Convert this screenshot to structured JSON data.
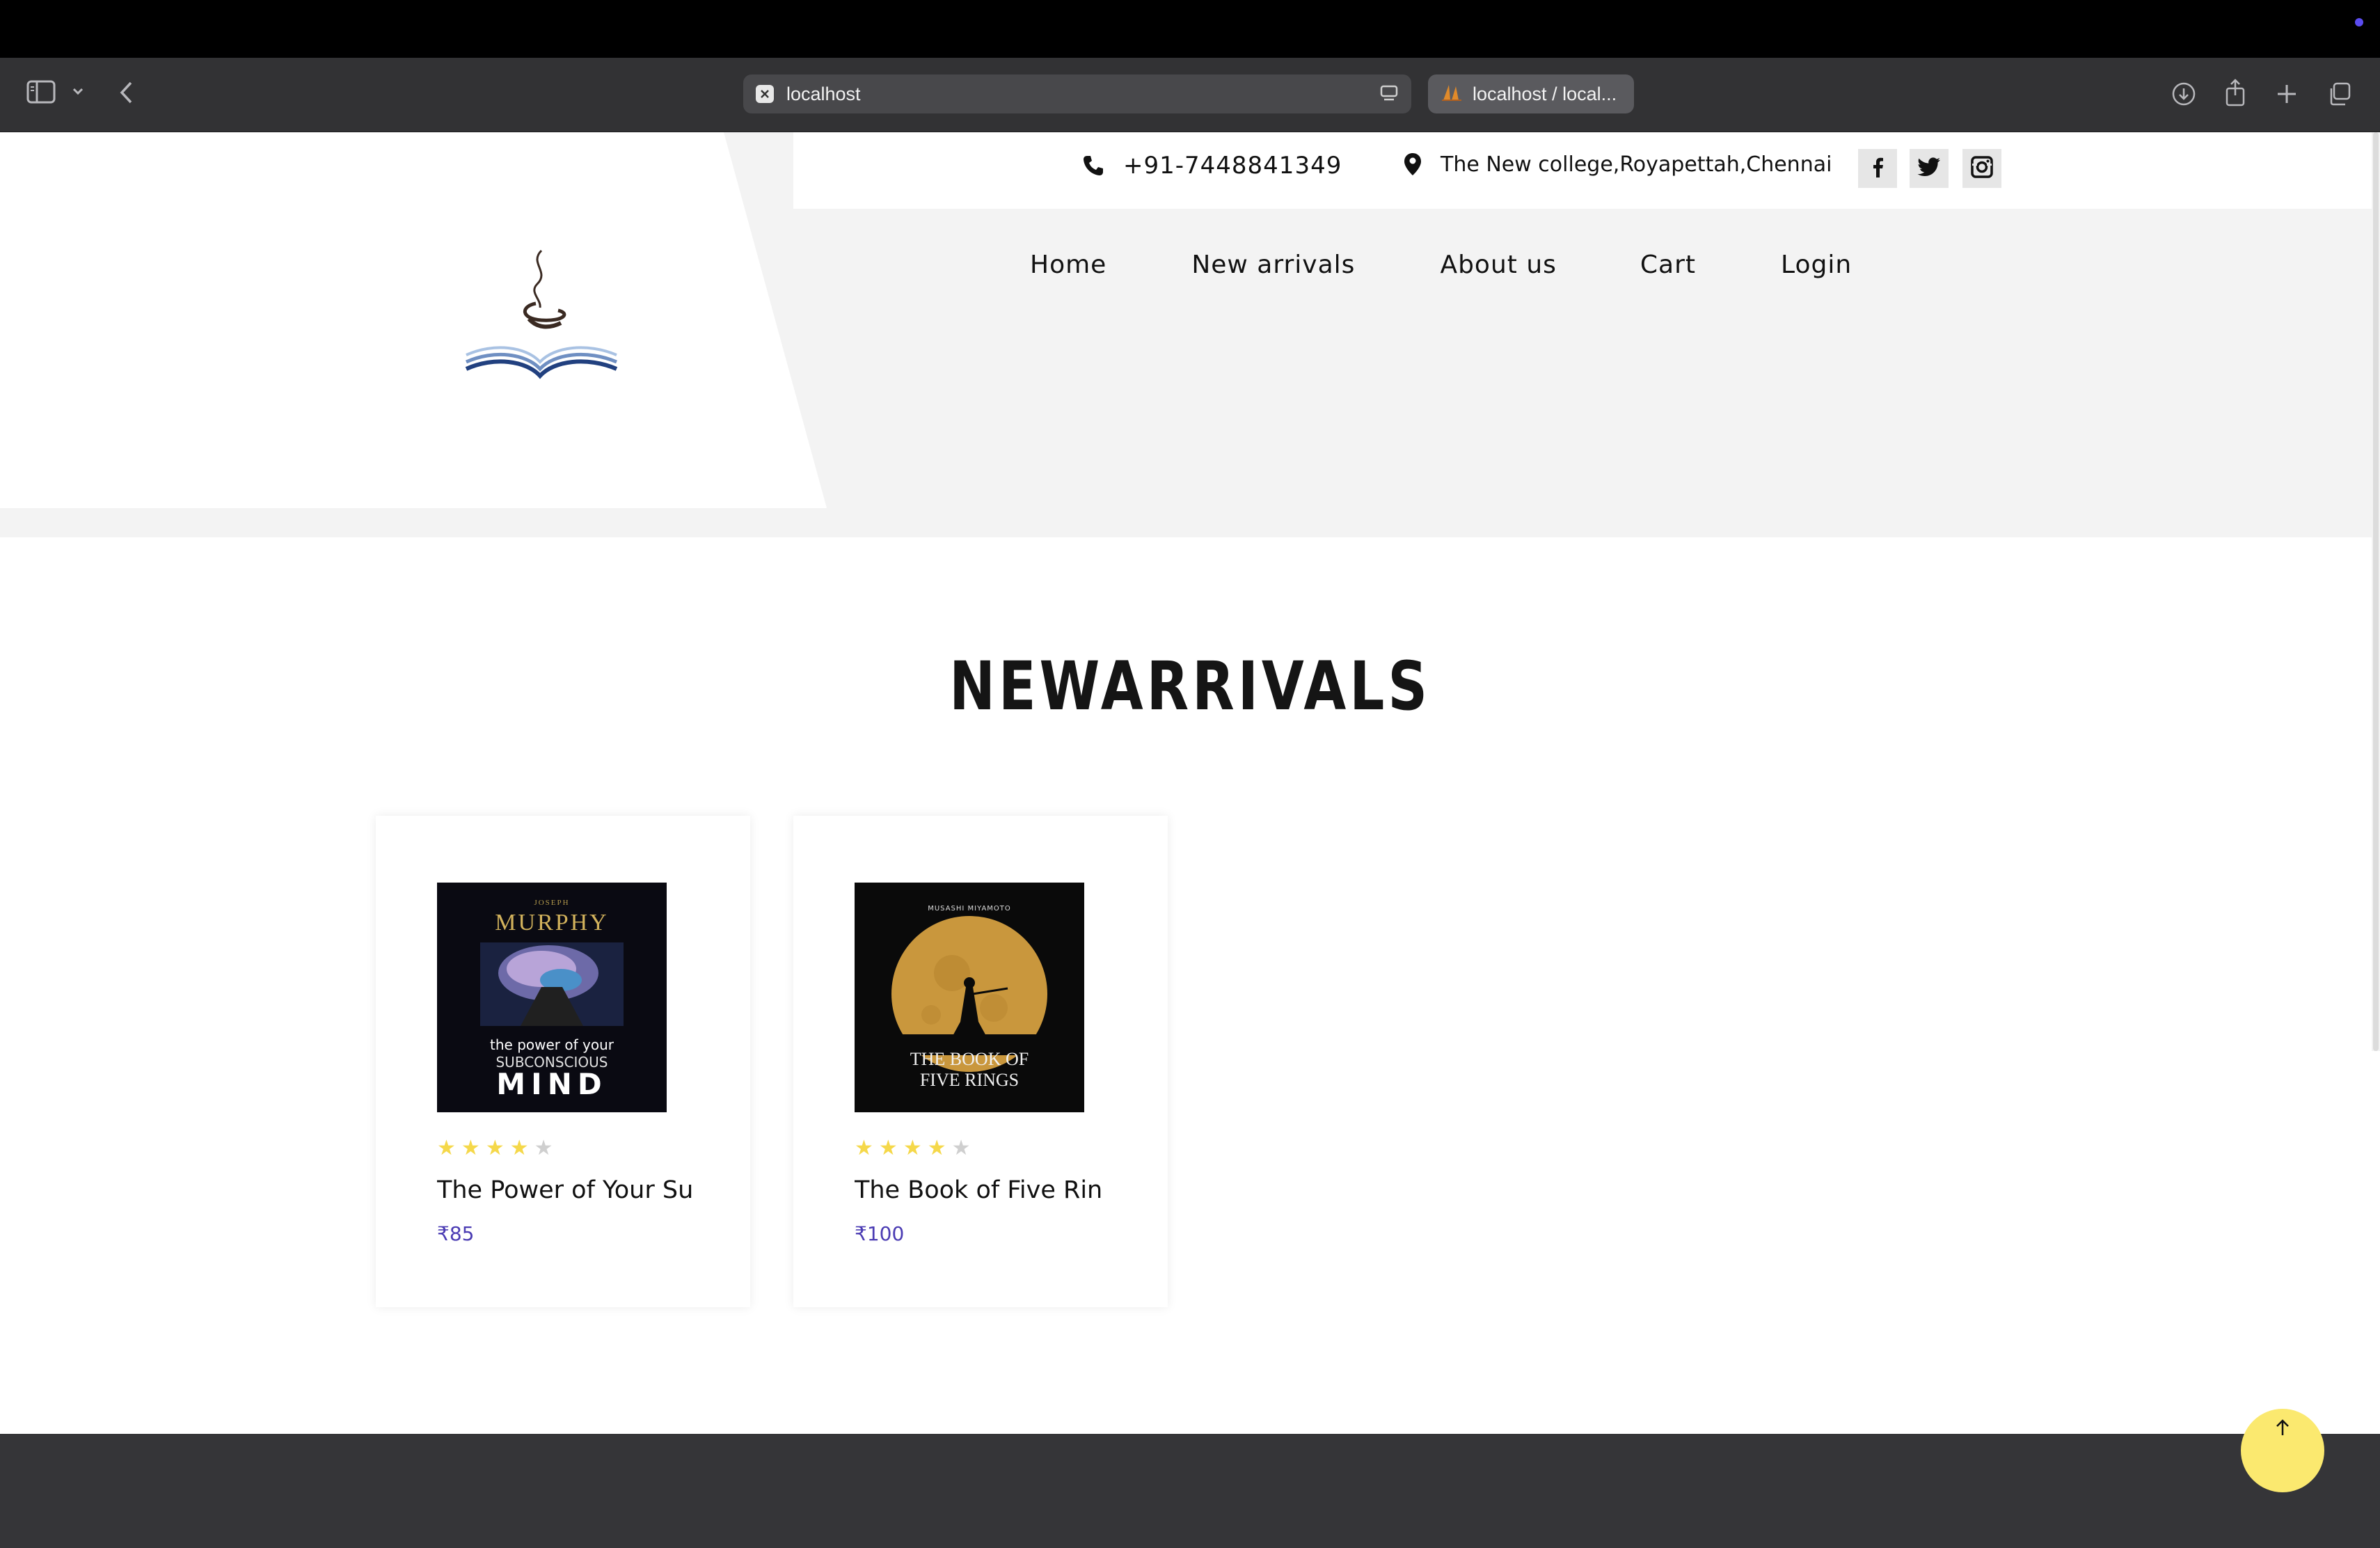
{
  "browser": {
    "active_tab_title": "localhost",
    "second_tab_title": "localhost / local..."
  },
  "header": {
    "phone": "+91-7448841349",
    "address": "The New college,Royapettah,Chennai",
    "nav": [
      {
        "label": "Home"
      },
      {
        "label": "New arrivals"
      },
      {
        "label": "About us"
      },
      {
        "label": "Cart"
      },
      {
        "label": "Login"
      }
    ]
  },
  "section": {
    "title": "NEWARRIVALS"
  },
  "books": [
    {
      "title": "The Power of Your Su",
      "price": "₹85",
      "rating": 4,
      "max_rating": 5,
      "cover": {
        "author": "MURPHY",
        "author_small": "JOSEPH",
        "line1": "the power of your",
        "line2": "SUBCONSCIOUS",
        "line3": "MIND"
      }
    },
    {
      "title": "The Book of Five Rin",
      "price": "₹100",
      "rating": 4,
      "max_rating": 5,
      "cover": {
        "author": "MUSASHI MIYAMOTO",
        "line1": "THE BOOK OF",
        "line2": "FIVE RINGS"
      }
    }
  ],
  "colors": {
    "accent_price": "#4a3bb3",
    "star_on": "#f5d84a",
    "star_off": "#cfcfcf",
    "scroll_button": "#fbe96f",
    "footer": "#353538"
  }
}
